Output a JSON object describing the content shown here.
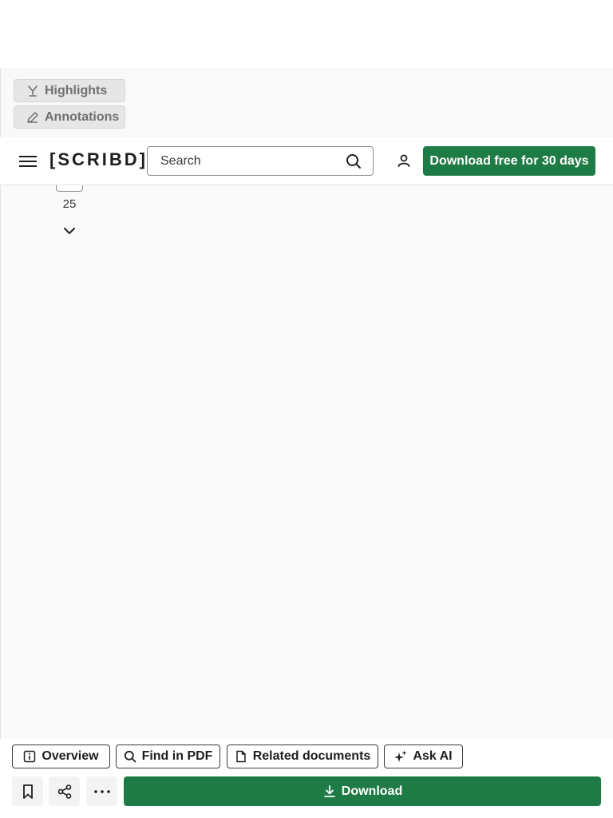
{
  "tools": {
    "highlights_label": "Highlights",
    "annotations_label": "Annotations"
  },
  "header": {
    "logo_text": "[SCRIBD]",
    "search_placeholder": "Search",
    "download_free_label": "Download free for 30 days"
  },
  "viewer": {
    "page_number": "25"
  },
  "bottom": {
    "tabs": [
      {
        "label": "Overview",
        "icon": "info-icon"
      },
      {
        "label": "Find in PDF",
        "icon": "search-icon"
      },
      {
        "label": "Related documents",
        "icon": "document-icon"
      },
      {
        "label": "Ask AI",
        "icon": "sparkle-icon"
      }
    ],
    "download_label": "Download"
  },
  "colors": {
    "brand_green": "#1e7b45",
    "viewer_bg": "#fafafa"
  }
}
